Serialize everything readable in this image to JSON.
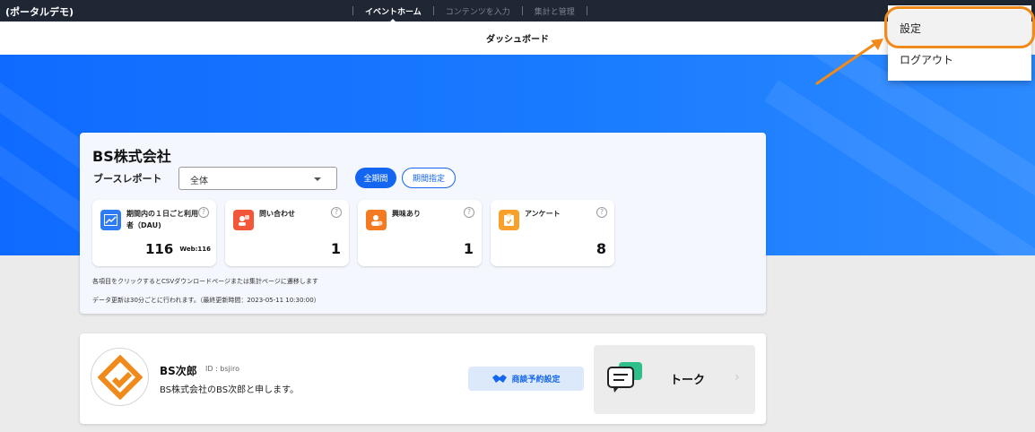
{
  "app": {
    "portal_name": "(ポータルデモ)"
  },
  "topnav": {
    "items": [
      {
        "label": "イベントホーム",
        "active": true
      },
      {
        "label": "コンテンツを入力",
        "active": false
      },
      {
        "label": "集計と管理",
        "active": false
      }
    ]
  },
  "header": {
    "title": "ダッシュボード"
  },
  "report": {
    "company": "BS株式会社",
    "booth_label": "ブースレポート",
    "select_value": "全体",
    "period_all": "全期間",
    "period_custom": "期間指定",
    "stats": [
      {
        "label": "期間内の１日ごと利用者（DAU)",
        "value": "116",
        "extra": "Web:116",
        "icon": "chart-up-icon",
        "color": "#2f7bf6"
      },
      {
        "label": "問い合わせ",
        "value": "1",
        "icon": "inquiry-icon",
        "color": "#f2573a"
      },
      {
        "label": "興味あり",
        "value": "1",
        "icon": "interest-icon",
        "color": "#f47a22"
      },
      {
        "label": "アンケート",
        "value": "8",
        "icon": "clipboard-icon",
        "color": "#f7a12a"
      }
    ],
    "help_glyph": "?",
    "note1": "各項目をクリックするとCSVダウンロードページまたは集計ページに遷移します",
    "note2": "データ更新は30分ごとに行われます。（最終更新時間：2023-05-11 10:30:00）"
  },
  "profile": {
    "name": "BS次郎",
    "id_text": "ID : bsjiro",
    "description": "BS株式会社のBS次郎と申します。",
    "meeting_button": "商談予約設定",
    "talk_label": "トーク",
    "talk_chevron": "›"
  },
  "menu": {
    "items": [
      "設定",
      "ログアウト"
    ]
  },
  "colors": {
    "accent": "#1466f0",
    "highlight": "#f08a1a",
    "hero": "#1a7cff"
  }
}
